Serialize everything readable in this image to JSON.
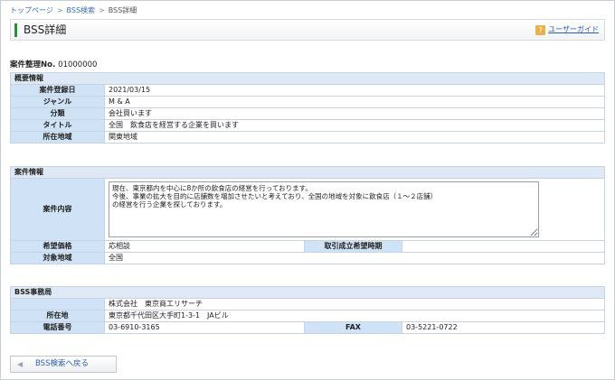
{
  "breadcrumb": {
    "items": [
      "トップページ",
      "BSS検索",
      "BSS詳細"
    ],
    "sep": ">"
  },
  "header": {
    "title": "BSS詳細",
    "guide_icon": "?",
    "guide_link": "ユーザーガイド"
  },
  "case_number": {
    "label": "案件整理No.",
    "value": "01000000"
  },
  "overview": {
    "heading": "概要情報",
    "rows": [
      {
        "label": "案件登録日",
        "value": "2021/03/15"
      },
      {
        "label": "ジャンル",
        "value": "M & A"
      },
      {
        "label": "分類",
        "value": "会社買います"
      },
      {
        "label": "タイトル",
        "value": "全国　飲食店を経営する企業を買います"
      },
      {
        "label": "所在地域",
        "value": "関東地域"
      }
    ]
  },
  "case_info": {
    "heading": "案件情報",
    "content_label": "案件内容",
    "content_text": "現在、東京都内を中心に8か所の飲食店の経営を行っております。\n今後、事業の拡大を目的に店舗数を増加させたいと考えており、全国の地域を対象に飲食店（１～２店舗）\nの経営を行う企業を探しております。",
    "price_label": "希望価格",
    "price_value": "応相談",
    "deal_label": "取引成立希望時期",
    "deal_value": "",
    "region_label": "対象地域",
    "region_value": "全国"
  },
  "office": {
    "heading": "BSS事務局",
    "company": "株式会社　東京商工リサーチ",
    "address_label": "所在地",
    "address_value": "東京都千代田区大手町1-3-1　JAビル",
    "phone_label": "電話番号",
    "phone_value": "03-6910-3165",
    "fax_label": "FAX",
    "fax_value": "03-5221-0722"
  },
  "back_button": {
    "arrow": "◀",
    "label": "BSS検索へ戻る"
  }
}
